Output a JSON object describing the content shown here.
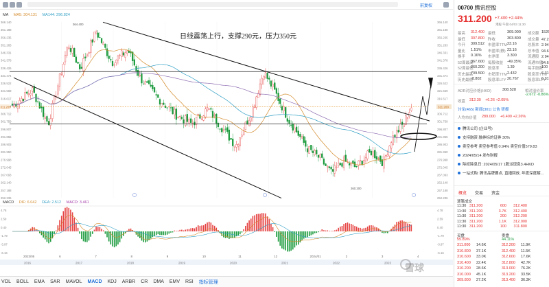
{
  "toolbar": {
    "right_label": "前复权"
  },
  "legend": {
    "ma": "MA",
    "ma5": "MA5: 304.131",
    "ma144": "MA144: 296.824"
  },
  "annotation": "日线震荡上行，支撑290元，压力350元",
  "price_axis": [
    "366.140",
    "361.188",
    "356.235",
    "351.283",
    "346.331",
    "341.378",
    "336.426",
    "331.474",
    "326.522",
    "321.569",
    "316.617",
    "311.664",
    "306.712",
    "301.759",
    "296.807",
    "291.855",
    "286.903",
    "281.950",
    "276.998",
    "272.045",
    "267.093",
    "262.140",
    "257.188",
    "252.236"
  ],
  "price_axis_right": [
    "366.140",
    "361.188",
    "356.235",
    "351.283",
    "346.331",
    "341.378",
    "336.426",
    "331.474",
    "326.522",
    "321.569",
    "316.617",
    "311.664",
    "306.712",
    "301.759",
    "296.807",
    "291.855",
    "286.903",
    "281.950",
    "276.998",
    "272.045",
    "267.093",
    "262.140",
    "257.188",
    "252.236"
  ],
  "current_price_tag": "311.200",
  "extremes": {
    "high": "364.400",
    "low": "260.200"
  },
  "macd_legend": {
    "name": "MACD",
    "dif": "DIF: 6.042",
    "dea": "DEA: 2.512",
    "macd": "MACD: 3.461"
  },
  "macd_axis": [
    "4.78",
    "2.59",
    "0.40",
    "-1.79",
    "-3.97",
    "-6.16"
  ],
  "x_axis_labels": [
    "2023/05",
    "6",
    "7",
    "8",
    "9",
    "10",
    "11",
    "12",
    "2024/01",
    "2",
    "3",
    "4"
  ],
  "x_axis_bottom": [
    "2016",
    "2017",
    "2018",
    "2019",
    "2020",
    "2021",
    "2022",
    "2023"
  ],
  "indicators": [
    "VOL",
    "BOLL",
    "EMA",
    "SAR",
    "MAVOL",
    "MACD",
    "KDJ",
    "ARBR",
    "CR",
    "DMA",
    "EMV",
    "RSI"
  ],
  "indicator_active": "MACD",
  "indicator_settings": "指标管理",
  "watermark": "雪球",
  "stock": {
    "code": "00700",
    "name": "腾讯控股",
    "price": "311.200",
    "change": "+7.400 +2.44%",
    "status": "港股 午盘 04/03 11:30"
  },
  "quote_rows": [
    [
      "最高",
      "312.400",
      "最低",
      "309.000",
      "成交额",
      "1526.58"
    ],
    [
      "最低",
      "307.800",
      "昨收",
      "303.800",
      "成交量",
      "47.25亿"
    ],
    [
      "今开",
      "309.512",
      "市盈率TTM",
      "23.16",
      "总股本",
      "2.94万亿"
    ],
    [
      "量比",
      "1.51%",
      "市盈率(静)",
      "23.16",
      "总市值",
      "94.62万亿"
    ],
    [
      "换手",
      "0.16%",
      "市净率",
      "3.300",
      "流通股",
      "2.94万亿"
    ],
    [
      "52周最高",
      "367.600",
      "每股收益",
      "-49.35%",
      "流通市值",
      "94.62万亿"
    ],
    [
      "52周最低",
      "260.200",
      "股息率",
      "1.39",
      "每手股数",
      "100"
    ],
    [
      "历史最高",
      "709.500",
      "市销率TTM",
      "2.432",
      "股息率TTM",
      "6.31%"
    ],
    [
      "历史最低",
      "-8.802",
      "股息率LFY",
      "20.767",
      "股息率LFY",
      "6.31%"
    ]
  ],
  "adr": {
    "label": "ADR对应价格(HKD)",
    "value": "308.528",
    "rel_label": "相对溢价率",
    "rel_value": "-2.672 -0.86%"
  },
  "after": {
    "label": "收盘",
    "price": "312.30",
    "change": "+6.26 +2.05%"
  },
  "social": {
    "talk": "讨论",
    "talk_count": "(465)",
    "news": "新闻",
    "news_count": "(301)",
    "notice": "公告",
    "ann": "研报"
  },
  "target": {
    "label": "人均市价值",
    "price": "289.000",
    "change": "+6.400 +2.26%"
  },
  "news": [
    "腾讯公司 (企业号)",
    "支持融资 融券标的证券 30%",
    "卖空参考 卖空参考值 0.94% 卖空价值579.83",
    "2024/05/14 发布财报",
    "除权除息日: 2024/05/17 1股派现息3.4HKD",
    "一站式购: 腾讯品牌要点, 直播回放, 年度深度解..."
  ],
  "tabs": [
    "概览",
    "交易",
    "资金"
  ],
  "trade_title": "逐笔成交",
  "trades": [
    [
      "11:30",
      "311.200",
      "600"
    ],
    [
      "11:30",
      "311.200",
      "3.7K"
    ],
    [
      "11:30",
      "311.200",
      "200"
    ],
    [
      "11:30",
      "311.200",
      "1.1K"
    ],
    [
      "11:30",
      "311.200",
      "100"
    ]
  ],
  "trades_right": [
    "312.400",
    "312.400",
    "312.200",
    "312.000",
    "311.800"
  ],
  "orderbook_header": {
    "buy": "买盘",
    "sell": "卖盘",
    "buy_pct": "55.89%",
    "sell_pct": "44.11%"
  },
  "orderbook": [
    [
      "311.000",
      "14.6K",
      "312.200",
      "11.9K"
    ],
    [
      "310.800",
      "37.1K",
      "312.400",
      "11.5K"
    ],
    [
      "310.600",
      "33.0K",
      "312.600",
      "17.6K"
    ],
    [
      "310.400",
      "22.4K",
      "312.800",
      "42.7K"
    ],
    [
      "310.200",
      "28.6K",
      "313.000",
      "76.2K"
    ],
    [
      "310.000",
      "45.1K",
      "313.200",
      "33.5K"
    ],
    [
      "309.800",
      "27.2K",
      "313.400",
      "36.3K"
    ]
  ],
  "chart_data": {
    "type": "candlestick",
    "title": "日线震荡上行，支撑290元，压力350元",
    "x": [
      "2023/05",
      "6",
      "7",
      "8",
      "9",
      "10",
      "11",
      "12",
      "2024/01",
      "2",
      "3",
      "4"
    ],
    "ylim": [
      252.236,
      366.14
    ],
    "series": [
      {
        "name": "MA5",
        "values": []
      },
      {
        "name": "MA144",
        "values": []
      }
    ],
    "annotations": {
      "high": 364.4,
      "low": 260.2,
      "current": 311.2,
      "support": 290,
      "resistance": 350
    }
  }
}
